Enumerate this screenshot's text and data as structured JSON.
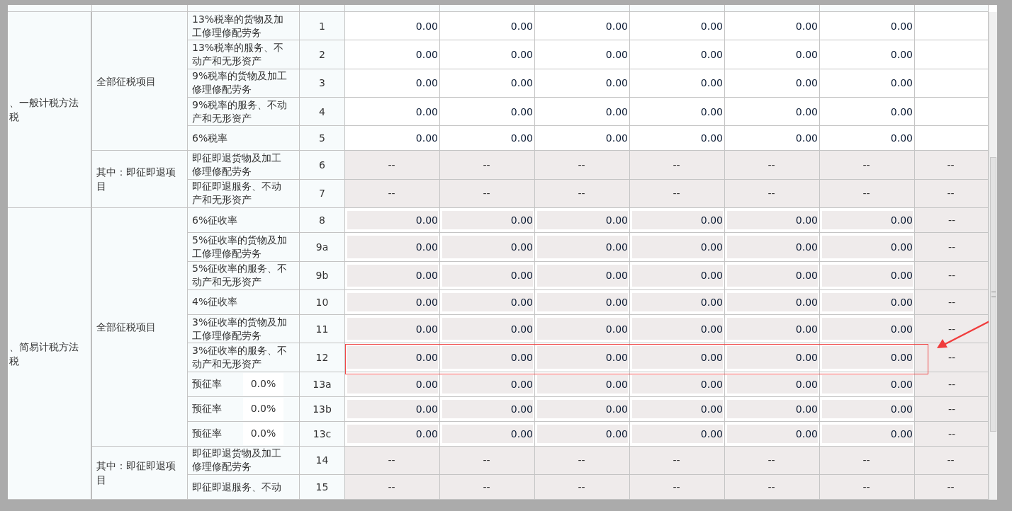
{
  "table": {
    "sections": [
      {
        "label_lines": [
          "、一般计税方法",
          "税"
        ],
        "groups": [
          {
            "label": "全部征税项目",
            "rows": [
              {
                "item": "13%税率的货物及加工修理修配劳务",
                "line": "1",
                "kind": "input",
                "cells": [
                  "0.00",
                  "0.00",
                  "0.00",
                  "0.00",
                  "0.00",
                  "0.00"
                ]
              },
              {
                "item": "13%税率的服务、不动产和无形资产",
                "line": "2",
                "kind": "input",
                "cells": [
                  "0.00",
                  "0.00",
                  "0.00",
                  "0.00",
                  "0.00",
                  "0.00"
                ]
              },
              {
                "item": "9%税率的货物及加工修理修配劳务",
                "line": "3",
                "kind": "input",
                "cells": [
                  "0.00",
                  "0.00",
                  "0.00",
                  "0.00",
                  "0.00",
                  "0.00"
                ]
              },
              {
                "item": "9%税率的服务、不动产和无形资产",
                "line": "4",
                "kind": "input",
                "cells": [
                  "0.00",
                  "0.00",
                  "0.00",
                  "0.00",
                  "0.00",
                  "0.00"
                ]
              },
              {
                "item": "6%税率",
                "line": "5",
                "kind": "input",
                "cells": [
                  "0.00",
                  "0.00",
                  "0.00",
                  "0.00",
                  "0.00",
                  "0.00"
                ]
              }
            ]
          },
          {
            "label": "其中：即征即退项目",
            "rows": [
              {
                "item": "即征即退货物及加工修理修配劳务",
                "line": "6",
                "kind": "locked",
                "cells": [
                  "--",
                  "--",
                  "--",
                  "--",
                  "--",
                  "--",
                  "--"
                ]
              },
              {
                "item": "即征即退服务、不动产和无形资产",
                "line": "7",
                "kind": "locked",
                "cells": [
                  "--",
                  "--",
                  "--",
                  "--",
                  "--",
                  "--",
                  "--"
                ]
              }
            ]
          }
        ]
      },
      {
        "label_lines": [
          "、简易计税方法",
          "税"
        ],
        "groups": [
          {
            "label": "全部征税项目",
            "rows": [
              {
                "item": "6%征收率",
                "line": "8",
                "kind": "computed",
                "cells": [
                  "0.00",
                  "0.00",
                  "0.00",
                  "0.00",
                  "0.00",
                  "0.00",
                  "--"
                ]
              },
              {
                "item": "5%征收率的货物及加工修理修配劳务",
                "line": "9a",
                "kind": "computed",
                "cells": [
                  "0.00",
                  "0.00",
                  "0.00",
                  "0.00",
                  "0.00",
                  "0.00",
                  "--"
                ]
              },
              {
                "item": "5%征收率的服务、不动产和无形资产",
                "line": "9b",
                "kind": "computed",
                "cells": [
                  "0.00",
                  "0.00",
                  "0.00",
                  "0.00",
                  "0.00",
                  "0.00",
                  "--"
                ]
              },
              {
                "item": "4%征收率",
                "line": "10",
                "kind": "computed",
                "cells": [
                  "0.00",
                  "0.00",
                  "0.00",
                  "0.00",
                  "0.00",
                  "0.00",
                  "--"
                ]
              },
              {
                "item": "3%征收率的货物及加工修理修配劳务",
                "line": "11",
                "kind": "computed",
                "cells": [
                  "0.00",
                  "0.00",
                  "0.00",
                  "0.00",
                  "0.00",
                  "0.00",
                  "--"
                ]
              },
              {
                "item": "3%征收率的服务、不动产和无形资产",
                "line": "12",
                "kind": "computed",
                "highlighted": true,
                "cells": [
                  "0.00",
                  "0.00",
                  "0.00",
                  "0.00",
                  "0.00",
                  "0.00",
                  "--"
                ]
              },
              {
                "item": "预征率",
                "rate": "0.0%",
                "line": "13a",
                "kind": "computed",
                "cells": [
                  "0.00",
                  "0.00",
                  "0.00",
                  "0.00",
                  "0.00",
                  "0.00",
                  "--"
                ]
              },
              {
                "item": "预征率",
                "rate": "0.0%",
                "line": "13b",
                "kind": "computed",
                "cells": [
                  "0.00",
                  "0.00",
                  "0.00",
                  "0.00",
                  "0.00",
                  "0.00",
                  "--"
                ]
              },
              {
                "item": "预征率",
                "rate": "0.0%",
                "line": "13c",
                "kind": "computed",
                "cells": [
                  "0.00",
                  "0.00",
                  "0.00",
                  "0.00",
                  "0.00",
                  "0.00",
                  "--"
                ]
              }
            ]
          },
          {
            "label": "其中：即征即退项目",
            "rows": [
              {
                "item": "即征即退货物及加工修理修配劳务",
                "line": "14",
                "kind": "locked",
                "cells": [
                  "--",
                  "--",
                  "--",
                  "--",
                  "--",
                  "--",
                  "--"
                ]
              },
              {
                "item": "即征即退服务、不动",
                "line": "15",
                "kind": "locked",
                "cells": [
                  "--",
                  "--",
                  "--",
                  "--",
                  "--",
                  "--",
                  "--"
                ]
              }
            ]
          }
        ]
      }
    ]
  }
}
